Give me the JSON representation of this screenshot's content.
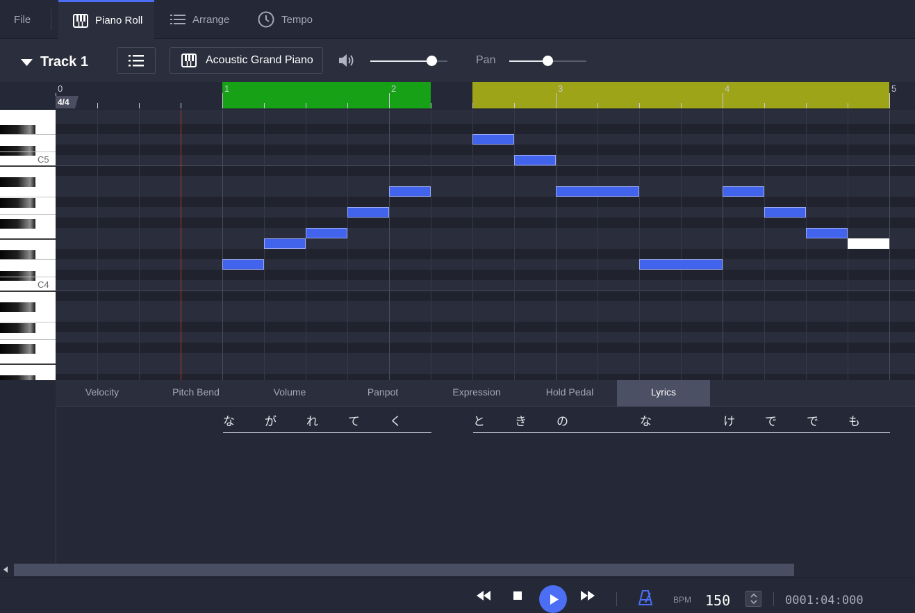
{
  "tabs": {
    "file": "File",
    "piano_roll": "Piano Roll",
    "arrange": "Arrange",
    "tempo": "Tempo"
  },
  "toolbar": {
    "track_name": "Track 1",
    "instrument": "Acoustic Grand Piano",
    "pan_label": "Pan",
    "volume_level": 0.8,
    "pan_level": 0.5
  },
  "ruler": {
    "time_signature": "4/4",
    "measures": [
      "0",
      "1",
      "2",
      "3",
      "4",
      "5"
    ],
    "loop_colors": [
      "#17a117",
      "#9da418"
    ]
  },
  "keyboard": {
    "labels": [
      "C5",
      "C4"
    ]
  },
  "controller_tabs": [
    "Velocity",
    "Pitch Bend",
    "Volume",
    "Panpot",
    "Expression",
    "Hold Pedal",
    "Lyrics"
  ],
  "active_controller_tab": "Lyrics",
  "lyrics": [
    "な",
    "が",
    "れ",
    "て",
    "く",
    "と",
    "き",
    "の",
    "な",
    "け",
    "で",
    "で",
    "も"
  ],
  "transport": {
    "bpm_label": "BPM",
    "bpm": "150",
    "position": "0001:04:000"
  },
  "colors": {
    "accent": "#4c6ef5",
    "note": "#4263eb",
    "playhead": "#c0392b"
  }
}
